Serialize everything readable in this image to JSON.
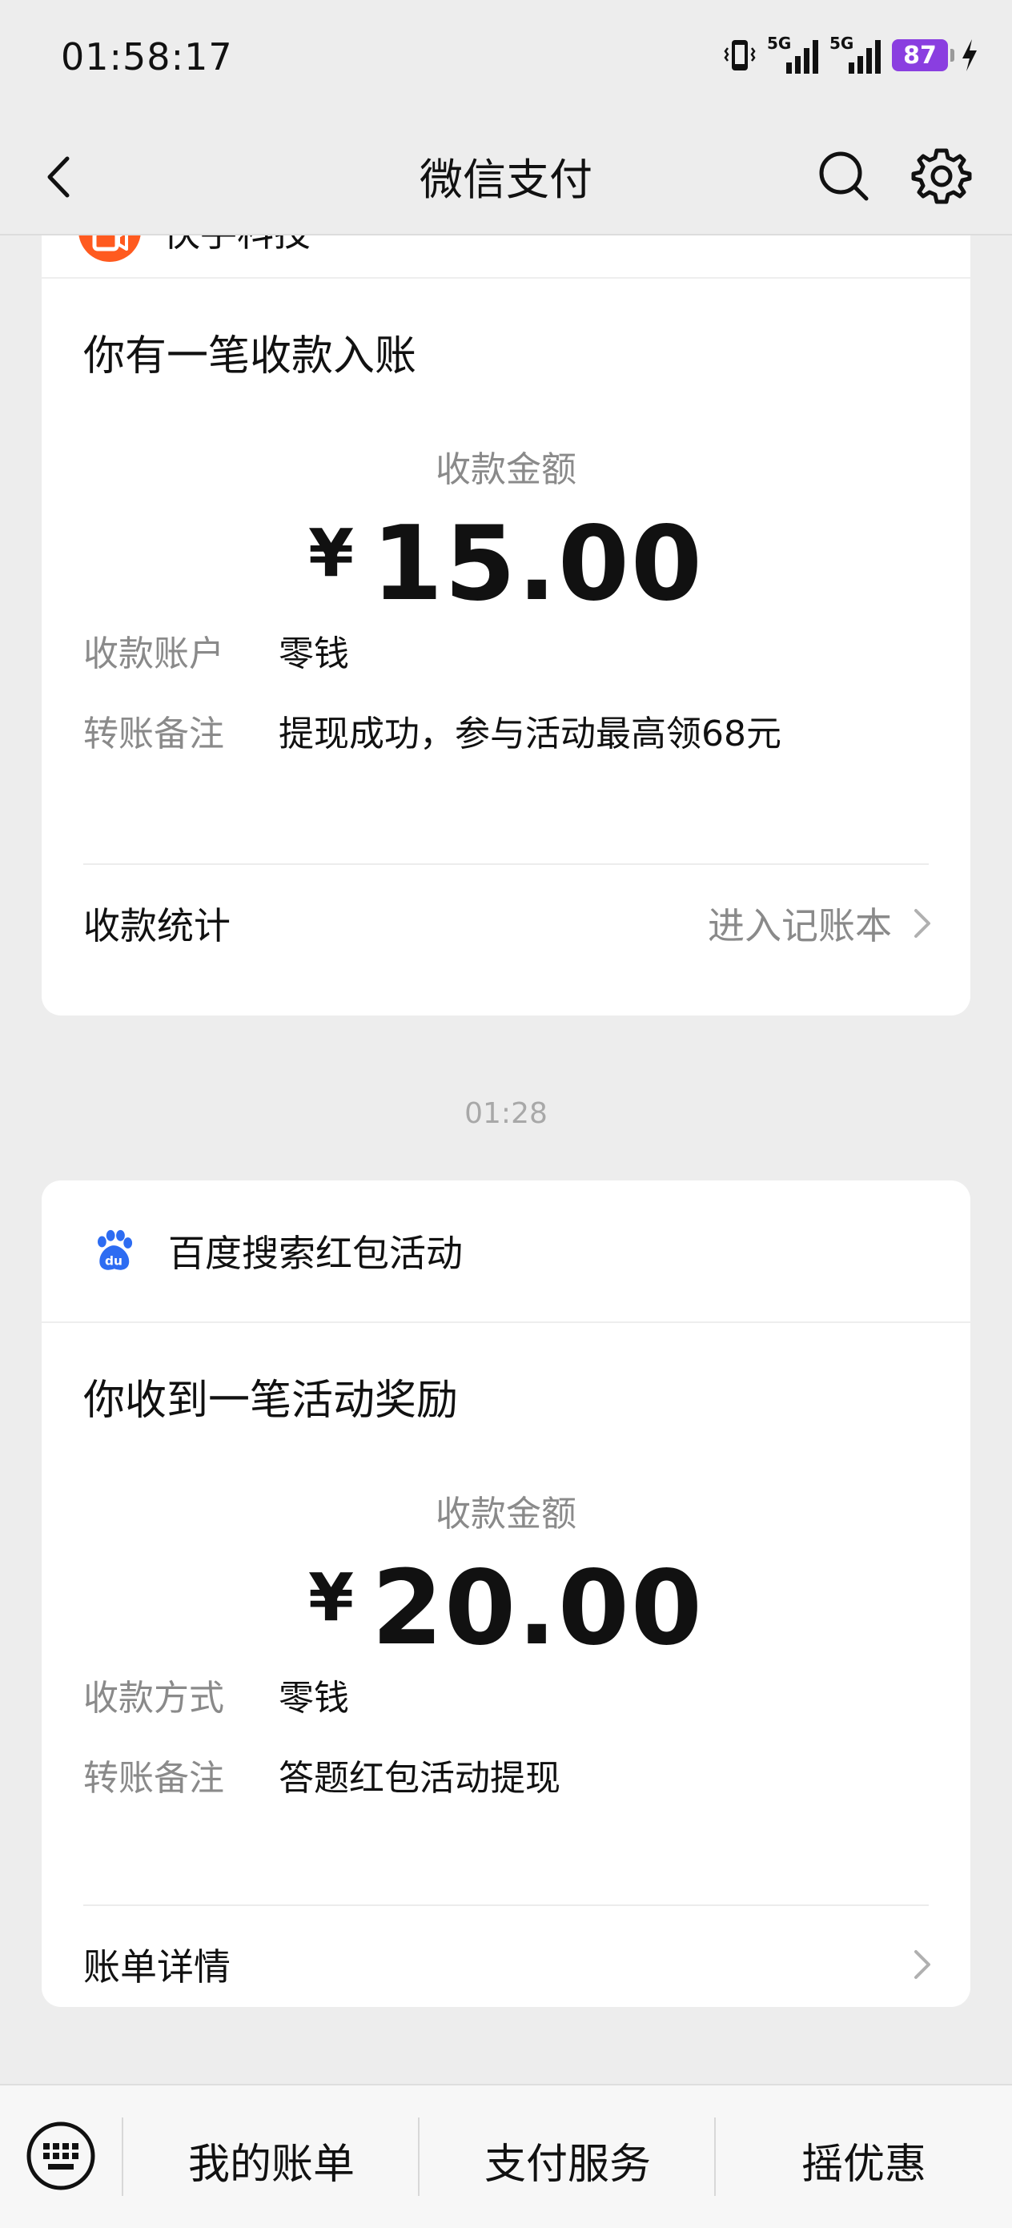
{
  "status_bar": {
    "time": "01:58:17",
    "signal1_label": "5G",
    "signal2_label": "5G",
    "battery": "87"
  },
  "nav": {
    "title": "微信支付"
  },
  "cards": [
    {
      "merchant": "快手科技",
      "title": "你有一笔收款入账",
      "amount_label": "收款金额",
      "currency": "¥",
      "amount": "15.00",
      "rows": [
        {
          "key": "收款账户",
          "value": "零钱"
        },
        {
          "key": "转账备注",
          "value": "提现成功，参与活动最高领68元"
        }
      ],
      "footer_left": "收款统计",
      "footer_right": "进入记账本"
    },
    {
      "merchant": "百度搜索红包活动",
      "title": "你收到一笔活动奖励",
      "amount_label": "收款金额",
      "currency": "¥",
      "amount": "20.00",
      "rows": [
        {
          "key": "收款方式",
          "value": "零钱"
        },
        {
          "key": "转账备注",
          "value": "答题红包活动提现"
        }
      ],
      "footer_left": "账单详情",
      "footer_right": ""
    }
  ],
  "timestamp": "01:28",
  "bottom_bar": {
    "items": [
      "我的账单",
      "支付服务",
      "摇优惠"
    ]
  },
  "colors": {
    "background": "#ededed",
    "card": "#ffffff",
    "muted_text": "#8a8a8a",
    "battery": "#8a3ee0"
  }
}
